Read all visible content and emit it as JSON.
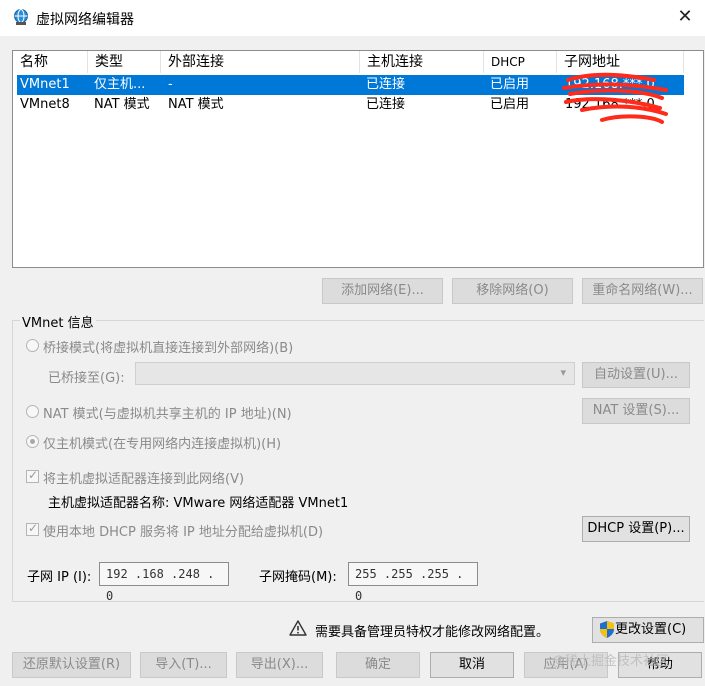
{
  "window": {
    "title": "虚拟网络编辑器",
    "close_glyph": "✕"
  },
  "table": {
    "headers": [
      "名称",
      "类型",
      "外部连接",
      "主机连接",
      "DHCP",
      "子网地址"
    ],
    "rows": [
      {
        "name": "VMnet1",
        "type": "仅主机...",
        "external": "-",
        "host": "已连接",
        "dhcp": "已启用",
        "subnet": "192.168.***.0",
        "selected": true
      },
      {
        "name": "VMnet8",
        "type": "NAT 模式",
        "external": "NAT 模式",
        "host": "已连接",
        "dhcp": "已启用",
        "subnet": "192.168.***.0",
        "selected": false
      }
    ]
  },
  "list_buttons": {
    "add": "添加网络(E)...",
    "remove": "移除网络(O)",
    "rename": "重命名网络(W)..."
  },
  "info": {
    "group_title": "VMnet 信息",
    "bridged_label": "桥接模式(将虚拟机直接连接到外部网络)(B)",
    "bridged_to_label": "已桥接至(G):",
    "auto_settings": "自动设置(U)...",
    "nat_label": "NAT 模式(与虚拟机共享主机的 IP 地址)(N)",
    "nat_settings": "NAT 设置(S)...",
    "hostonly_label": "仅主机模式(在专用网络内连接虚拟机)(H)",
    "connect_adapter_label": "将主机虚拟适配器连接到此网络(V)",
    "adapter_name_label": "主机虚拟适配器名称: VMware 网络适配器 VMnet1",
    "dhcp_label": "使用本地 DHCP 服务将 IP 地址分配给虚拟机(D)",
    "dhcp_settings": "DHCP 设置(P)...",
    "subnet_ip_label": "子网 IP (I):",
    "subnet_ip_value": "192 .168 .248 .  0",
    "subnet_mask_label": "子网掩码(M):",
    "subnet_mask_value": "255 .255 .255 .  0"
  },
  "admin": {
    "message": "需要具备管理员特权才能修改网络配置。",
    "change_settings": "更改设置(C)"
  },
  "footer": {
    "restore": "还原默认设置(R)",
    "import": "导入(T)...",
    "export": "导出(X)...",
    "ok": "确定",
    "cancel": "取消",
    "apply": "应用(A)",
    "help": "帮助"
  },
  "watermark": "@稀土掘金技术社区",
  "colors": {
    "selection": "#0078d7",
    "scribble": "#ff2a1a",
    "dialog_bg": "#f0f0f0"
  }
}
